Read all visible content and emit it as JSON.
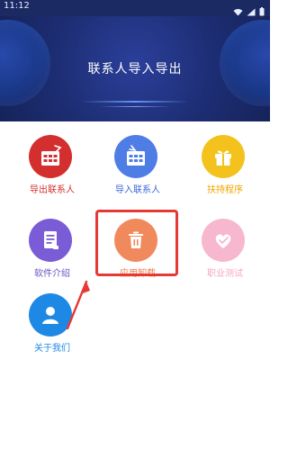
{
  "status_bar": {
    "time": "11:12"
  },
  "header": {
    "title": "联系人导入导出"
  },
  "grid": {
    "items": [
      {
        "label": "导出联系人",
        "label_color": "#d32f2f",
        "icon_bg": "#d32f2f",
        "icon": "grid-table-export-icon"
      },
      {
        "label": "导入联系人",
        "label_color": "#3b68d8",
        "icon_bg": "#4f7de6",
        "icon": "grid-table-import-icon"
      },
      {
        "label": "扶持程序",
        "label_color": "#f0a400",
        "icon_bg": "#f4c21d",
        "icon": "gift-icon"
      },
      {
        "label": "软件介绍",
        "label_color": "#6a4fc8",
        "icon_bg": "#7a5cd6",
        "icon": "document-icon"
      },
      {
        "label": "应用卸载",
        "label_color": "#ee7a45",
        "icon_bg": "#f08a5d",
        "icon": "trash-icon"
      },
      {
        "label": "职业测试",
        "label_color": "#f3a9c3",
        "icon_bg": "#f7b7cf",
        "icon": "heart-icon"
      },
      {
        "label": "关于我们",
        "label_color": "#1e88e5",
        "icon_bg": "#1e88e5",
        "icon": "person-icon"
      }
    ]
  },
  "annotation": {
    "highlight_color": "#e53935"
  }
}
